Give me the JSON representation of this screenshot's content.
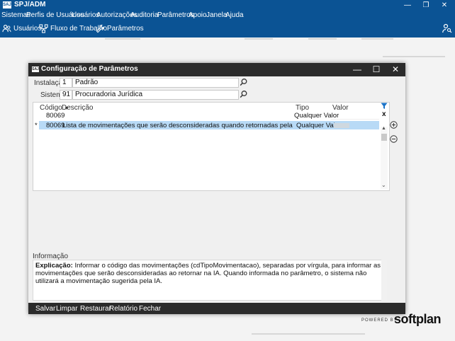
{
  "app": {
    "logo_text": "SAJ",
    "title": "SPJ/ADM",
    "controls": {
      "minimize": "—",
      "maximize": "❐",
      "close": "✕"
    }
  },
  "menu": [
    {
      "label": "Sistemas"
    },
    {
      "label": "Perfis de Usuários"
    },
    {
      "label": "Usuários"
    },
    {
      "label": "Autorizações"
    },
    {
      "label": "Auditoria"
    },
    {
      "label": "Parâmetros"
    },
    {
      "label": "Apoio"
    },
    {
      "label": "Janela"
    },
    {
      "label": "Ajuda"
    }
  ],
  "toolbar": {
    "usuarios": "Usuários",
    "fluxo": "Fluxo de Trabalho",
    "parametros": "Parâmetros"
  },
  "dialog": {
    "logo_text": "SAJ",
    "title": "Configuração de Parâmetros",
    "controls": {
      "minimize": "—",
      "maximize": "☐",
      "close": "✕"
    },
    "instalacao": {
      "label": "Instalação",
      "code": "1",
      "name": "Padrão"
    },
    "sistema": {
      "label": "Sistema",
      "code": "91",
      "name": "Procuradoria Jurídica"
    },
    "grid": {
      "headers": {
        "codigo": "Código",
        "descricao": "Descrição",
        "tipo": "Tipo",
        "valor": "Valor"
      },
      "filter": {
        "codigo": "80069",
        "tipo": "Qualquer Valor",
        "clear": "x"
      },
      "rows": [
        {
          "marker": "*",
          "codigo": "80069",
          "descricao": "Lista de movimentações que serão desconsideradas quando retornadas pela inteligencia artificial.",
          "tipo": "Qualquer Valor"
        }
      ]
    },
    "info": {
      "label": "Informação",
      "bold": "Explicação:",
      "text": " Informar o código das movimentações (cdTipoMovimentacao), separadas por vírgula, para informar as movimentações que serão desconsideradas ao retornar na IA. Quando informada no parâmetro, o sistema não utilizará a movimentação sugerida pela IA."
    },
    "footer": {
      "salvar": "Salvar",
      "limpar": "Limpar",
      "restaurar": "Restaurar",
      "relatorio": "Relatório",
      "fechar": "Fechar"
    }
  },
  "brand": {
    "powered": "POWERED BY",
    "name": "softplan"
  }
}
